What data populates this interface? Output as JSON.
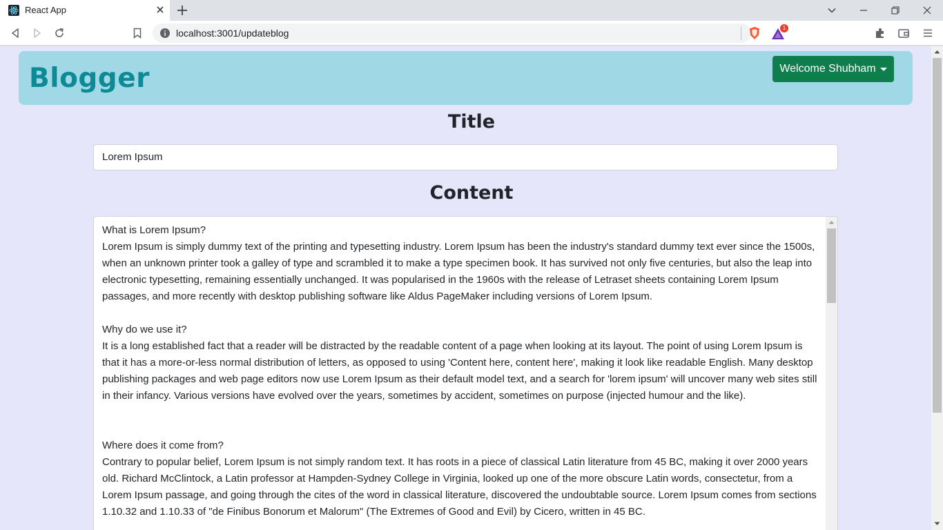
{
  "browser": {
    "tab_title": "React App",
    "url": "localhost:3001/updateblog",
    "shield_badge": "1"
  },
  "navbar": {
    "brand": "Blogger",
    "user_menu": "Welcome Shubham"
  },
  "form": {
    "title_heading": "Title",
    "title_value": "Lorem Ipsum",
    "content_heading": "Content",
    "content_value": "What is Lorem Ipsum?\nLorem Ipsum is simply dummy text of the printing and typesetting industry. Lorem Ipsum has been the industry's standard dummy text ever since the 1500s, when an unknown printer took a galley of type and scrambled it to make a type specimen book. It has survived not only five centuries, but also the leap into electronic typesetting, remaining essentially unchanged. It was popularised in the 1960s with the release of Letraset sheets containing Lorem Ipsum passages, and more recently with desktop publishing software like Aldus PageMaker including versions of Lorem Ipsum.\n\nWhy do we use it?\nIt is a long established fact that a reader will be distracted by the readable content of a page when looking at its layout. The point of using Lorem Ipsum is that it has a more-or-less normal distribution of letters, as opposed to using 'Content here, content here', making it look like readable English. Many desktop publishing packages and web page editors now use Lorem Ipsum as their default model text, and a search for 'lorem ipsum' will uncover many web sites still in their infancy. Various versions have evolved over the years, sometimes by accident, sometimes on purpose (injected humour and the like).\n\n\nWhere does it come from?\nContrary to popular belief, Lorem Ipsum is not simply random text. It has roots in a piece of classical Latin literature from 45 BC, making it over 2000 years old. Richard McClintock, a Latin professor at Hampden-Sydney College in Virginia, looked up one of the more obscure Latin words, consectetur, from a Lorem Ipsum passage, and going through the cites of the word in classical literature, discovered the undoubtable source. Lorem Ipsum comes from sections 1.10.32 and 1.10.33 of \"de Finibus Bonorum et Malorum\" (The Extremes of Good and Evil) by Cicero, written in 45 BC."
  }
}
